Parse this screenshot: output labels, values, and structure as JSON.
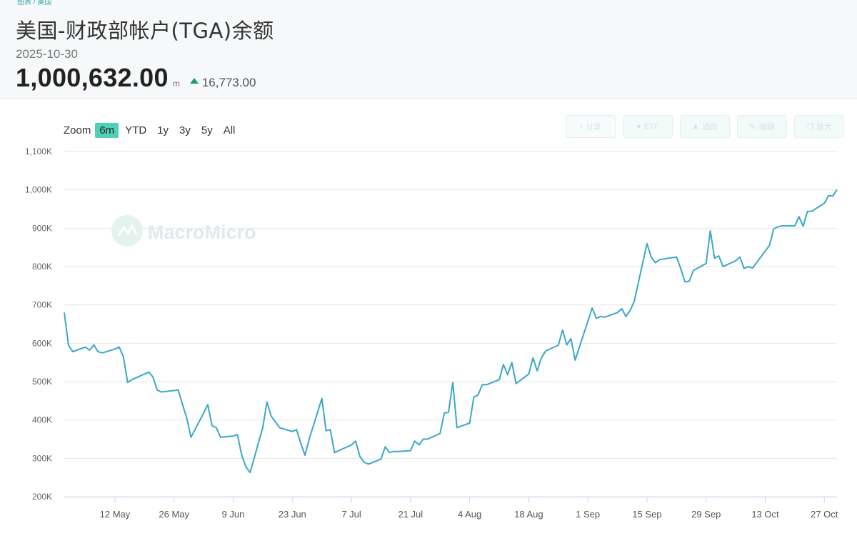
{
  "header": {
    "breadcrumb": "图表 / 美国",
    "title": "美国-财政部帐户(TGA)余额",
    "date": "2025-10-30",
    "value": "1,000,632.00",
    "unit": "m",
    "change": "16,773.00",
    "change_color": "#1a9e6e"
  },
  "zoom": {
    "label": "Zoom",
    "options": [
      "6m",
      "YTD",
      "1y",
      "3y",
      "5y",
      "All"
    ],
    "active": "6m",
    "active_color": "#4fd1b5"
  },
  "toolbar": {
    "buttons": [
      {
        "label": "分享",
        "icon": "share-icon"
      },
      {
        "label": "ETF",
        "icon": "etf-icon"
      },
      {
        "label": "追踪",
        "icon": "user-icon"
      },
      {
        "label": "编辑",
        "icon": "edit-icon"
      },
      {
        "label": "放大",
        "icon": "expand-icon"
      }
    ]
  },
  "watermark": {
    "text": "MacroMicro"
  },
  "chart_data": {
    "type": "line",
    "title": "",
    "xlabel": "",
    "ylabel": "",
    "line_color": "#3aa7c9",
    "ylim": [
      200000,
      1100000
    ],
    "yticks": [
      200000,
      300000,
      400000,
      500000,
      600000,
      700000,
      800000,
      900000,
      1000000,
      1100000
    ],
    "ytick_labels": [
      "200K",
      "300K",
      "400K",
      "500K",
      "600K",
      "700K",
      "800K",
      "900K",
      "1,000K",
      "1,100K"
    ],
    "xlim": [
      "2025-04-30",
      "2025-10-30"
    ],
    "xticks": [
      "2025-05-12",
      "2025-05-26",
      "2025-06-09",
      "2025-06-23",
      "2025-07-07",
      "2025-07-21",
      "2025-08-04",
      "2025-08-18",
      "2025-09-01",
      "2025-09-15",
      "2025-09-29",
      "2025-10-13",
      "2025-10-27"
    ],
    "xtick_labels": [
      "12 May",
      "26 May",
      "9 Jun",
      "23 Jun",
      "7 Jul",
      "21 Jul",
      "4 Aug",
      "18 Aug",
      "1 Sep",
      "15 Sep",
      "29 Sep",
      "13 Oct",
      "27 Oct"
    ],
    "grid": true,
    "legend": "none",
    "series": [
      {
        "x": [
          "2025-04-30",
          "2025-05-01",
          "2025-05-02",
          "2025-05-05",
          "2025-05-06",
          "2025-05-07",
          "2025-05-08",
          "2025-05-09",
          "2025-05-12",
          "2025-05-13",
          "2025-05-14",
          "2025-05-15",
          "2025-05-16",
          "2025-05-19",
          "2025-05-20",
          "2025-05-21",
          "2025-05-22",
          "2025-05-23",
          "2025-05-27",
          "2025-05-28",
          "2025-05-29",
          "2025-05-30",
          "2025-06-02",
          "2025-06-03",
          "2025-06-04",
          "2025-06-05",
          "2025-06-06",
          "2025-06-09",
          "2025-06-10",
          "2025-06-11",
          "2025-06-12",
          "2025-06-13",
          "2025-06-16",
          "2025-06-17",
          "2025-06-18",
          "2025-06-20",
          "2025-06-23",
          "2025-06-24",
          "2025-06-25",
          "2025-06-26",
          "2025-06-27",
          "2025-06-30",
          "2025-07-01",
          "2025-07-02",
          "2025-07-03",
          "2025-07-07",
          "2025-07-08",
          "2025-07-09",
          "2025-07-10",
          "2025-07-11",
          "2025-07-14",
          "2025-07-15",
          "2025-07-16",
          "2025-07-17",
          "2025-07-18",
          "2025-07-21",
          "2025-07-22",
          "2025-07-23",
          "2025-07-24",
          "2025-07-25",
          "2025-07-28",
          "2025-07-29",
          "2025-07-30",
          "2025-07-31",
          "2025-08-01",
          "2025-08-04",
          "2025-08-05",
          "2025-08-06",
          "2025-08-07",
          "2025-08-08",
          "2025-08-11",
          "2025-08-12",
          "2025-08-13",
          "2025-08-14",
          "2025-08-15",
          "2025-08-18",
          "2025-08-19",
          "2025-08-20",
          "2025-08-21",
          "2025-08-22",
          "2025-08-25",
          "2025-08-26",
          "2025-08-27",
          "2025-08-28",
          "2025-08-29",
          "2025-09-02",
          "2025-09-03",
          "2025-09-04",
          "2025-09-05",
          "2025-09-08",
          "2025-09-09",
          "2025-09-10",
          "2025-09-11",
          "2025-09-12",
          "2025-09-15",
          "2025-09-16",
          "2025-09-17",
          "2025-09-18",
          "2025-09-19",
          "2025-09-22",
          "2025-09-23",
          "2025-09-24",
          "2025-09-25",
          "2025-09-26",
          "2025-09-29",
          "2025-09-30",
          "2025-10-01",
          "2025-10-02",
          "2025-10-03",
          "2025-10-06",
          "2025-10-07",
          "2025-10-08",
          "2025-10-09",
          "2025-10-10",
          "2025-10-14",
          "2025-10-15",
          "2025-10-16",
          "2025-10-17",
          "2025-10-20",
          "2025-10-21",
          "2025-10-22",
          "2025-10-23",
          "2025-10-24",
          "2025-10-27",
          "2025-10-28",
          "2025-10-29",
          "2025-10-30"
        ],
        "y": [
          680000,
          595000,
          578000,
          590000,
          582000,
          596000,
          578000,
          575000,
          585000,
          590000,
          565000,
          498000,
          505000,
          520000,
          525000,
          512000,
          478000,
          473000,
          478000,
          440000,
          405000,
          355000,
          418000,
          440000,
          385000,
          380000,
          355000,
          358000,
          362000,
          310000,
          278000,
          263000,
          380000,
          447000,
          410000,
          380000,
          370000,
          375000,
          340000,
          308000,
          350000,
          456000,
          372000,
          375000,
          315000,
          335000,
          345000,
          305000,
          290000,
          285000,
          298000,
          330000,
          315000,
          318000,
          318000,
          320000,
          345000,
          335000,
          350000,
          350000,
          365000,
          418000,
          420000,
          498000,
          380000,
          392000,
          460000,
          465000,
          492000,
          492000,
          505000,
          545000,
          518000,
          550000,
          495000,
          520000,
          562000,
          528000,
          562000,
          580000,
          595000,
          635000,
          596000,
          612000,
          556000,
          692000,
          665000,
          670000,
          668000,
          680000,
          690000,
          670000,
          685000,
          710000,
          860000,
          825000,
          810000,
          818000,
          820000,
          825000,
          795000,
          760000,
          762000,
          790000,
          808000,
          893000,
          822000,
          828000,
          800000,
          815000,
          825000,
          795000,
          800000,
          796000,
          855000,
          898000,
          904000,
          906000,
          906000,
          930000,
          905000,
          944000,
          944000,
          965000,
          985000,
          984000,
          1000632
        ]
      }
    ]
  }
}
